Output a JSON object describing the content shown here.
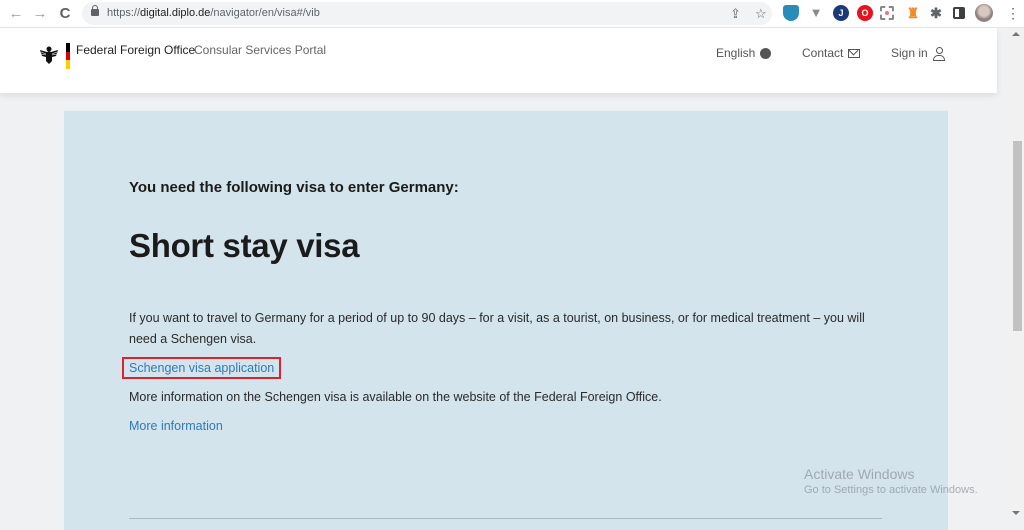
{
  "browser": {
    "nav": {
      "back_icon": "←",
      "forward_icon": "→",
      "reload_icon": "C"
    },
    "url_scheme": "https://",
    "url_host": "digital.diplo.de",
    "url_path": "/navigator/en/visa#/vib",
    "omnibox_icons": {
      "share": "⇪",
      "bookmark": "☆"
    },
    "extensions": [
      {
        "name": "shield-extension",
        "glyph": ""
      },
      {
        "name": "v-extension",
        "glyph": "▼"
      },
      {
        "name": "blue-extension",
        "glyph": "J"
      },
      {
        "name": "opera-extension",
        "glyph": "O"
      },
      {
        "name": "scan-extension",
        "glyph": ""
      },
      {
        "name": "orange-extension",
        "glyph": "♜"
      },
      {
        "name": "puzzle-extension",
        "glyph": "✱"
      }
    ],
    "menu_glyph": "⋮"
  },
  "header": {
    "brand": "Federal Foreign Office",
    "portal": "Consular Services Portal",
    "nav": {
      "language": "English",
      "contact": "Contact",
      "sign_in": "Sign in"
    },
    "flag_colors": [
      "#000000",
      "#dd0000",
      "#ffce00"
    ]
  },
  "main": {
    "eyebrow": "You need the following visa to enter Germany:",
    "title": "Short stay visa",
    "description": "If you want to travel to Germany for a period of up to 90 days – for a visit, as a tourist, on business, or for medical treatment – you will need a Schengen visa.",
    "application_link": "Schengen visa application",
    "more_text": "More information on the Schengen visa is available on the website of the Federal Foreign Office.",
    "more_link": "More information"
  },
  "colors": {
    "card_bg": "#d4e4ec",
    "link": "#2f7ab8",
    "highlight": "#d9232d"
  },
  "watermark": {
    "title": "Activate Windows",
    "subtitle": "Go to Settings to activate Windows."
  }
}
